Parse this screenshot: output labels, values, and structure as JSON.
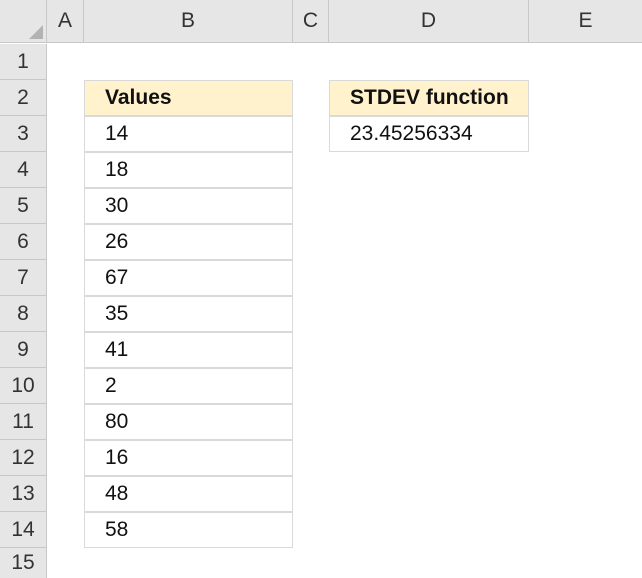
{
  "columns": [
    "A",
    "B",
    "C",
    "D",
    "E"
  ],
  "rows": [
    "1",
    "2",
    "3",
    "4",
    "5",
    "6",
    "7",
    "8",
    "9",
    "10",
    "11",
    "12",
    "13",
    "14",
    "15"
  ],
  "table_values": {
    "header": "Values",
    "values": [
      "14",
      "18",
      "30",
      "26",
      "67",
      "35",
      "41",
      "2",
      "80",
      "16",
      "48",
      "58"
    ]
  },
  "result": {
    "header": "STDEV function",
    "value": "23.45256334"
  }
}
